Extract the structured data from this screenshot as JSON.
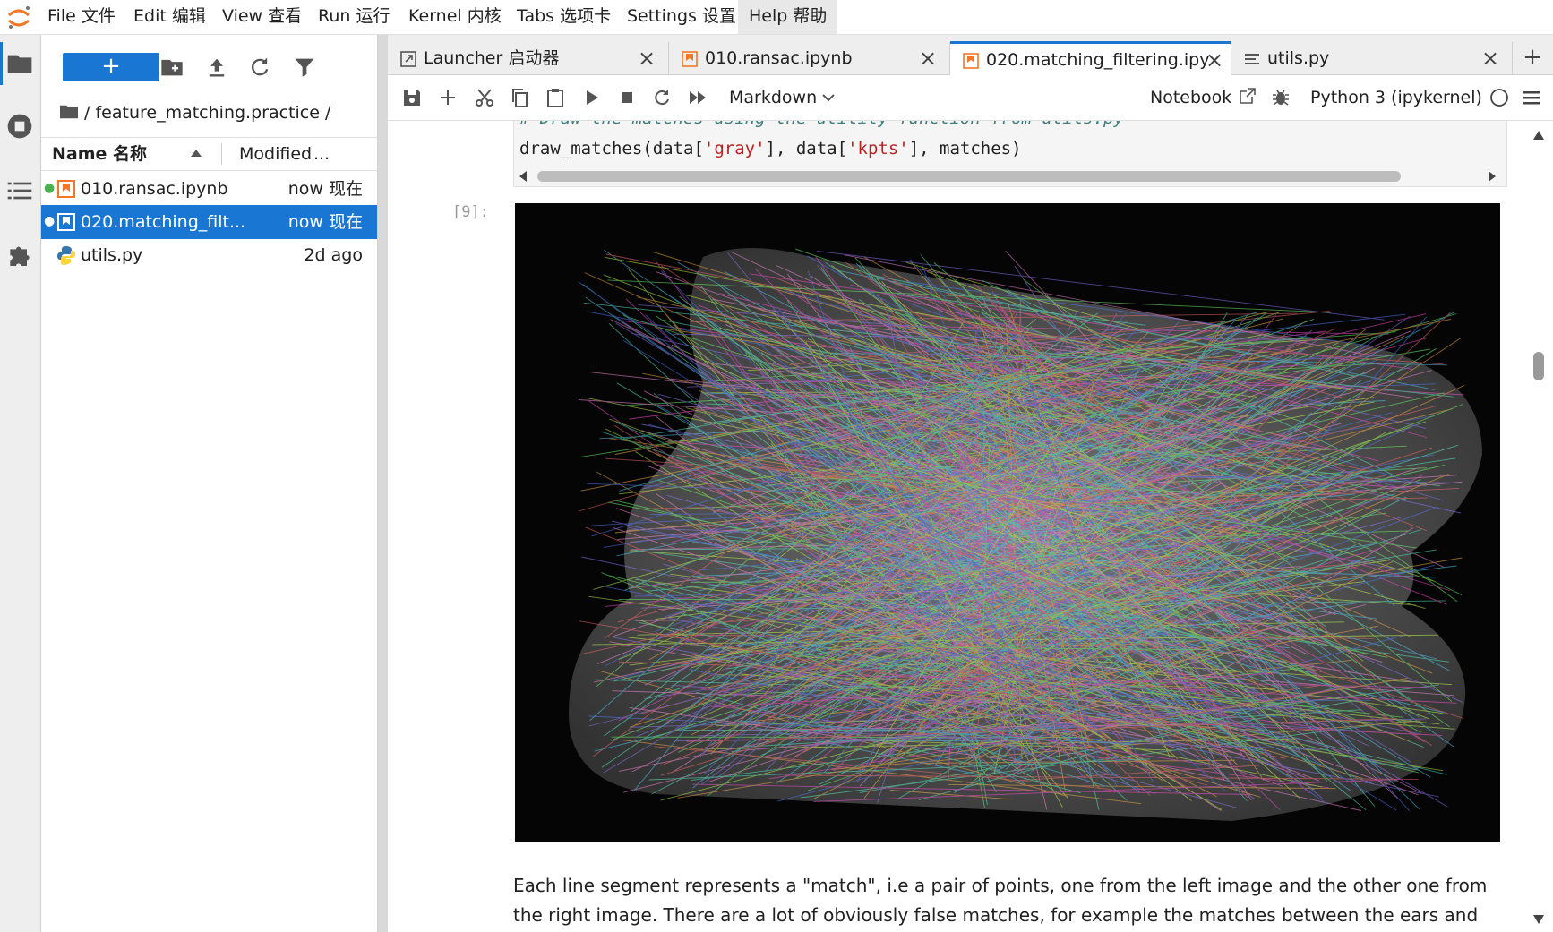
{
  "menubar": {
    "items": [
      "File 文件",
      "Edit 编辑",
      "View 查看",
      "Run 运行",
      "Kernel 内核",
      "Tabs 选项卡",
      "Settings 设置",
      "Help 帮助"
    ],
    "active_item": "Help 帮助"
  },
  "filebrowser": {
    "new_button_label": "+",
    "breadcrumb": "/ feature_matching.practice /",
    "columns": {
      "name": "Name 名称",
      "modified": "Modified",
      "more": "..."
    },
    "files": [
      {
        "name": "010.ransac.ipynb",
        "modified": "now 现在",
        "type": "notebook",
        "running": true
      },
      {
        "name": "020.matching_filt...",
        "modified": "now 现在",
        "type": "notebook",
        "running": true,
        "selected": true
      },
      {
        "name": "utils.py",
        "modified": "2d ago",
        "type": "python"
      }
    ]
  },
  "tabs": [
    {
      "label": "Launcher 启动器",
      "icon": "launcher-icon"
    },
    {
      "label": "010.ransac.ipynb",
      "icon": "notebook-icon"
    },
    {
      "label": "020.matching_filtering.ipy",
      "icon": "notebook-icon",
      "active": true
    },
    {
      "label": "utils.py",
      "icon": "text-file-icon"
    }
  ],
  "add_tab_label": "+",
  "nbtoolbar": {
    "cell_type": "Markdown",
    "notebook_label": "Notebook",
    "kernel_name": "Python 3 (ipykernel)"
  },
  "cell": {
    "comment_line": "# Draw the matches using the utility function from utils.py",
    "code_line": {
      "p1": "draw_matches(data[",
      "s1": "'gray'",
      "p2": "], data[",
      "s2": "'kpts'",
      "p3": "], matches)"
    },
    "output_prompt": "[9]:"
  },
  "markdown": {
    "text": "Each line segment represents a \"match\", i.e a pair of points, one from the left image and the other one from the right image. There are a lot of obviously false matches, for example the matches between the ears and"
  },
  "colors": {
    "accent": "#1976d2",
    "string": "#ba2121",
    "comment": "#408080",
    "notebook_orange": "#f37726"
  }
}
